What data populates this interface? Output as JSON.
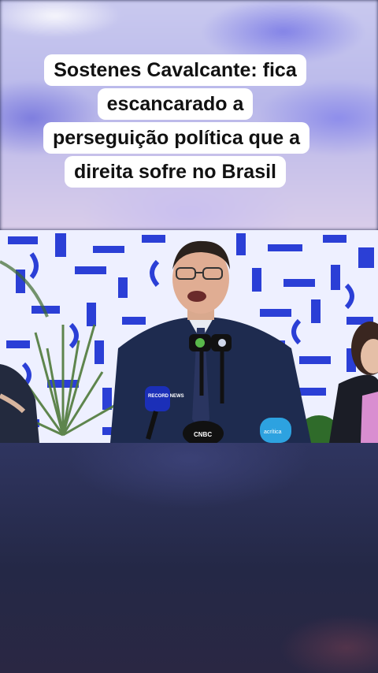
{
  "headline": {
    "text": "Sostenes Cavalcante: fica escancarado a perseguição política que a direita sofre no Brasil"
  },
  "microphones": {
    "left_mic_label": "RECORD NEWS",
    "center_mic_label": "CNBC",
    "right_mic_label": "acrítica"
  },
  "colors": {
    "tile_blue": "#2b3fd6",
    "suit": "#1e2b4f",
    "caption_bg": "#ffffff"
  }
}
